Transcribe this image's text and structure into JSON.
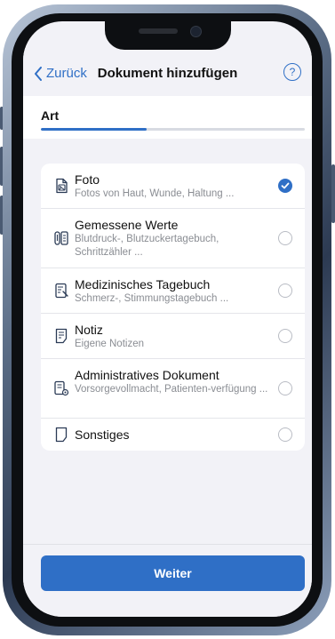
{
  "nav": {
    "back_label": "Zurück",
    "title": "Dokument hinzufügen",
    "help_symbol": "?"
  },
  "step": {
    "label": "Art",
    "progress_percent": 40
  },
  "document_types": [
    {
      "title": "Foto",
      "subtitle": "Fotos von Haut, Wunde, Haltung ...",
      "icon": "photo-document-icon",
      "selected": true
    },
    {
      "title": "Gemessene Werte",
      "subtitle": "Blutdruck-, Blutzuckertagebuch, Schrittzähler ...",
      "icon": "measurement-icon",
      "selected": false
    },
    {
      "title": "Medizinisches Tagebuch",
      "subtitle": "Schmerz-, Stimmungstagebuch ...",
      "icon": "medical-diary-icon",
      "selected": false
    },
    {
      "title": "Notiz",
      "subtitle": "Eigene Notizen",
      "icon": "note-icon",
      "selected": false
    },
    {
      "title": "Administratives Dokument",
      "subtitle": "Vorsorgevollmacht, Patienten-verfügung ...",
      "icon": "admin-document-icon",
      "selected": false
    },
    {
      "title": "Sonstiges",
      "subtitle": "",
      "icon": "generic-document-icon",
      "selected": false
    }
  ],
  "footer": {
    "next_label": "Weiter"
  },
  "colors": {
    "accent": "#2f6fc6",
    "background": "#f2f2f7",
    "card": "#ffffff"
  }
}
